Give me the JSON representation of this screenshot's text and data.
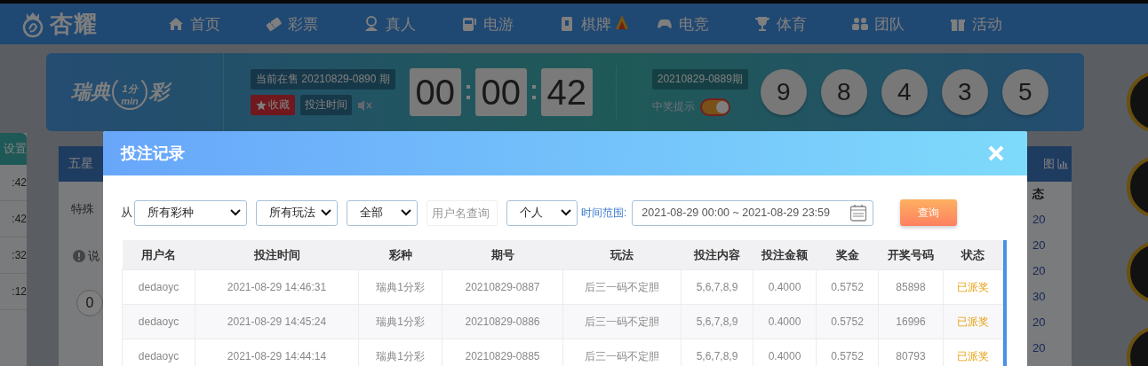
{
  "nav": {
    "logo": "杏耀",
    "items": [
      {
        "label": "首页",
        "hot": false
      },
      {
        "label": "彩票",
        "hot": false
      },
      {
        "label": "真人",
        "hot": false
      },
      {
        "label": "电游",
        "hot": false
      },
      {
        "label": "棋牌",
        "hot": true
      },
      {
        "label": "电竞",
        "hot": false
      },
      {
        "label": "体育",
        "hot": false
      },
      {
        "label": "团队",
        "hot": false
      },
      {
        "label": "活动",
        "hot": false
      }
    ]
  },
  "banner": {
    "logo": {
      "left": "瑞典",
      "clock": "1分",
      "unit": "min",
      "right": "彩"
    },
    "current_issue": "当前在售 20210829-0890 期",
    "favorite": "收藏",
    "bet_time": "投注时间",
    "muted": true,
    "countdown": [
      "00",
      "00",
      "42"
    ],
    "last_issue": "20210829-0889期",
    "win_alert": {
      "label": "中奖提示",
      "on": true
    },
    "balls": [
      "9",
      "8",
      "4",
      "3",
      "5"
    ]
  },
  "sidebar": {
    "title": "设置",
    "times": [
      ":42",
      ":42",
      ":32",
      ":12"
    ]
  },
  "main_panel": {
    "tab": "五星",
    "row_label": "特殊",
    "note": "说",
    "ball": "0"
  },
  "right_panel": {
    "header": "图",
    "column": "态",
    "values": [
      "20",
      "20",
      "20",
      "30",
      "20",
      "20"
    ]
  },
  "modal": {
    "title": "投注记录",
    "filters": [
      {
        "kind": "prefix",
        "text": "从"
      },
      {
        "kind": "select",
        "value": "所有彩种"
      },
      {
        "kind": "select",
        "value": "所有玩法"
      },
      {
        "kind": "select",
        "value": "全部"
      },
      {
        "kind": "input",
        "placeholder": "用户名查询"
      },
      {
        "kind": "select",
        "value": "个人"
      },
      {
        "kind": "label",
        "text": "时间范围:"
      },
      {
        "kind": "date",
        "value": "2021-08-29 00:00 ~ 2021-08-29 23:59"
      },
      {
        "kind": "button",
        "text": "查询"
      }
    ],
    "table": {
      "columns": [
        "用户名",
        "投注时间",
        "彩种",
        "期号",
        "玩法",
        "投注内容",
        "投注金额",
        "奖金",
        "开奖号码",
        "状态"
      ],
      "rows": [
        [
          "dedaoyc",
          "2021-08-29 14:46:31",
          "瑞典1分彩",
          "20210829-0887",
          "后三一码不定胆",
          "5,6,7,8,9",
          "0.4000",
          "0.5752",
          "85898",
          "已派奖"
        ],
        [
          "dedaoyc",
          "2021-08-29 14:45:24",
          "瑞典1分彩",
          "20210829-0886",
          "后三一码不定胆",
          "5,6,7,8,9",
          "0.4000",
          "0.5752",
          "16996",
          "已派奖"
        ],
        [
          "dedaoyc",
          "2021-08-29 14:44:14",
          "瑞典1分彩",
          "20210829-0885",
          "后三一码不定胆",
          "5,6,7,8,9",
          "0.4000",
          "0.5752",
          "80793",
          "已派奖"
        ]
      ]
    }
  }
}
